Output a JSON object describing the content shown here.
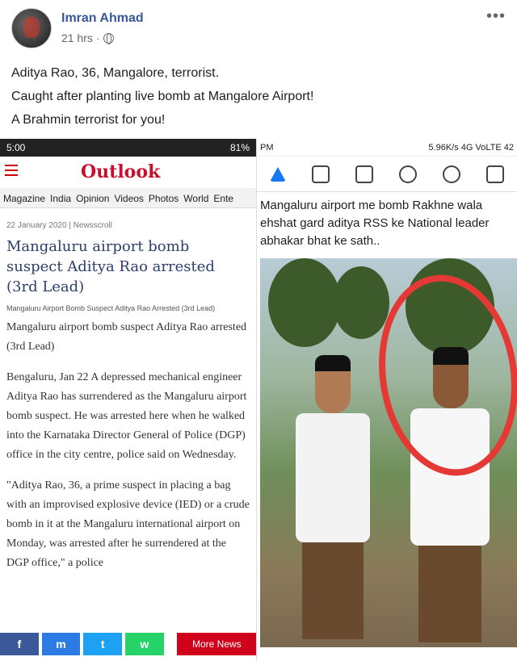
{
  "post": {
    "author": "Imran Ahmad",
    "time": "21 hrs",
    "separator": "·",
    "lines": [
      "Aditya Rao, 36, Mangalore, terrorist.",
      "Caught after planting live bomb at Mangalore Airport!",
      "A Brahmin terrorist for you!"
    ]
  },
  "left": {
    "status_time": "5:00",
    "status_battery": "81%",
    "logo": "Outlook",
    "nav": [
      "Magazine",
      "India",
      "Opinion",
      "Videos",
      "Photos",
      "World",
      "Ente"
    ],
    "date": "22 January 2020  |  Newsscroll",
    "headline": "Mangaluru airport bomb suspect Aditya Rao arrested (3rd Lead)",
    "subtag": "Mangaluru Airport Bomb Suspect Aditya Rao Arrested (3rd Lead)",
    "lead": "Mangaluru airport bomb suspect Aditya Rao arrested (3rd Lead)",
    "body1": "Bengaluru, Jan 22 A depressed mechanical engineer Aditya Rao has surrendered as the Mangaluru airport bomb suspect. He was arrested here when he walked into the Karnataka Director General of Police (DGP) office in the city centre, police said on Wednesday.",
    "body2": "\"Aditya Rao, 36, a prime suspect in placing a bag with an improvised explosive device (IED) or a crude bomb in it at the Mangaluru international airport on Monday, was arrested after he surrendered at the DGP office,\" a police",
    "share": {
      "fb": "f",
      "ms": "m",
      "tw": "t",
      "wa": "w"
    },
    "more_news": "More News"
  },
  "right": {
    "status_left": "PM",
    "status_right": "5.96K/s  4G VoLTE  42",
    "text": "Mangaluru airport me bomb Rakhne wala ehshat gard aditya RSS ke National leader abhakar bhat ke sath.."
  }
}
